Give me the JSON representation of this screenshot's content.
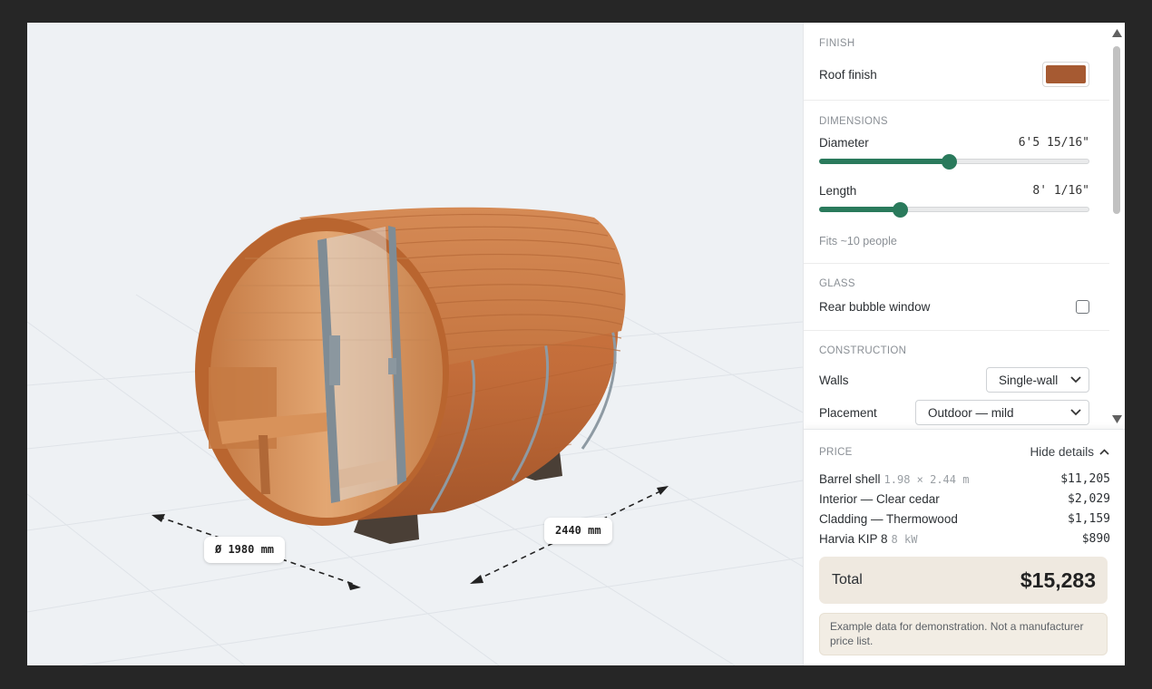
{
  "viewport": {
    "diameter_label": "Ø 1980 mm",
    "length_label": "2440 mm"
  },
  "finish": {
    "section_title": "FINISH",
    "roof_label": "Roof finish",
    "roof_color": "#a65a32"
  },
  "dimensions": {
    "section_title": "DIMENSIONS",
    "diameter": {
      "label": "Diameter",
      "value": "6'5 15/16\"",
      "fraction": 0.48
    },
    "length": {
      "label": "Length",
      "value": "8' 1/16\"",
      "fraction": 0.3
    },
    "fits_text": "Fits ~10 people"
  },
  "glass": {
    "section_title": "GLASS",
    "rear_window_label": "Rear bubble window",
    "rear_window_checked": false
  },
  "construction": {
    "section_title": "CONSTRUCTION",
    "walls_label": "Walls",
    "walls_value": "Single-wall",
    "placement_label": "Placement",
    "placement_value": "Outdoor — mild"
  },
  "price": {
    "section_title": "PRICE",
    "toggle_label": "Hide details",
    "lines": [
      {
        "label": "Barrel shell",
        "detail": "1.98 × 2.44 m",
        "amount": "$11,205"
      },
      {
        "label": "Interior — Clear cedar",
        "detail": "",
        "amount": "$2,029"
      },
      {
        "label": "Cladding — Thermowood",
        "detail": "",
        "amount": "$1,159"
      },
      {
        "label": "Harvia KIP 8",
        "detail": "8 kW",
        "amount": "$890"
      }
    ],
    "total_label": "Total",
    "total_value": "$15,283",
    "note": "Example data for demonstration. Not a manufacturer price list."
  },
  "colors": {
    "accent": "#2a7a5c",
    "wood": "#c26f3c",
    "total_bg": "#efe9e0"
  }
}
